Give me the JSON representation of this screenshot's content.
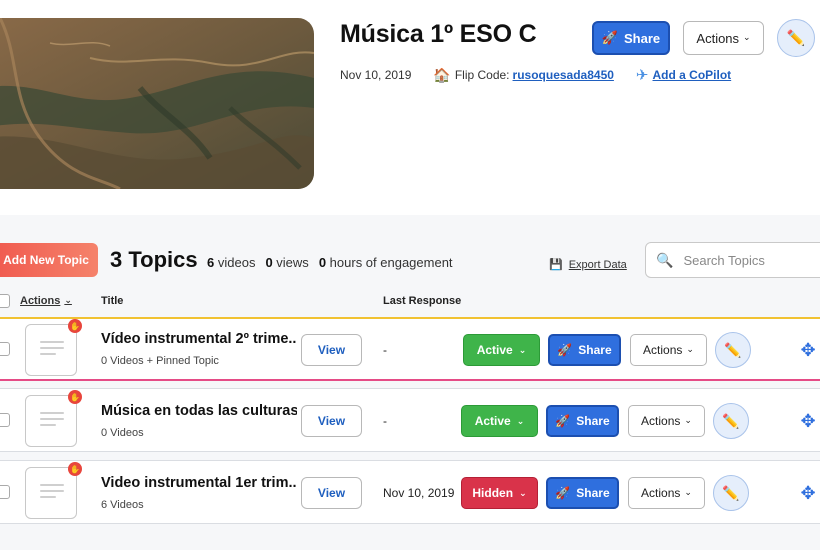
{
  "header": {
    "title": "Música 1º ESO C",
    "date": "Nov 10, 2019",
    "flip_code_label": "Flip Code:",
    "flip_code": "rusoquesada8450",
    "copilot_link": "Add a CoPilot",
    "share_label": "Share",
    "actions_label": "Actions",
    "cover_image": "satellite-terrain-cover"
  },
  "toolbar": {
    "add_topic_label": "Add New Topic",
    "topics_count": "3 Topics",
    "stats": {
      "videos_num": "6",
      "videos_label": "videos",
      "views_num": "0",
      "views_label": "views",
      "hours_num": "0",
      "hours_label": "hours of engagement"
    },
    "export_label": "Export Data",
    "search_placeholder": "Search Topics"
  },
  "columns": {
    "actions": "Actions",
    "title": "Title",
    "last_response": "Last Response"
  },
  "topics": [
    {
      "title": "Vídeo instrumental 2º trime...",
      "subtitle": "0 Videos + Pinned Topic",
      "view_label": "View",
      "last_response": "-",
      "status": "Active",
      "share_label": "Share",
      "actions_label": "Actions"
    },
    {
      "title": "Música en todas las culturas",
      "subtitle": "0 Videos",
      "view_label": "View",
      "last_response": "-",
      "status": "Active",
      "share_label": "Share",
      "actions_label": "Actions"
    },
    {
      "title": "Video instrumental 1er trim...",
      "subtitle": "6 Videos",
      "view_label": "View",
      "last_response": "Nov 10, 2019",
      "status": "Hidden",
      "share_label": "Share",
      "actions_label": "Actions"
    }
  ],
  "colors": {
    "brand_blue": "#2f6fde",
    "active_green": "#3fb44a",
    "hidden_red": "#d9334a",
    "add_topic_gradient": "#f05a4f",
    "pinned_top_border": "#f1c232",
    "pinned_bottom_border": "#e54b86"
  },
  "icons": {
    "share": "rocket-icon",
    "edit": "pencil-icon",
    "move": "move-arrows-icon",
    "flip_code": "house-icon",
    "copilot": "airplane-icon",
    "export": "floppy-disk-icon",
    "search": "search-icon",
    "pinned_badge": "hand-icon"
  }
}
